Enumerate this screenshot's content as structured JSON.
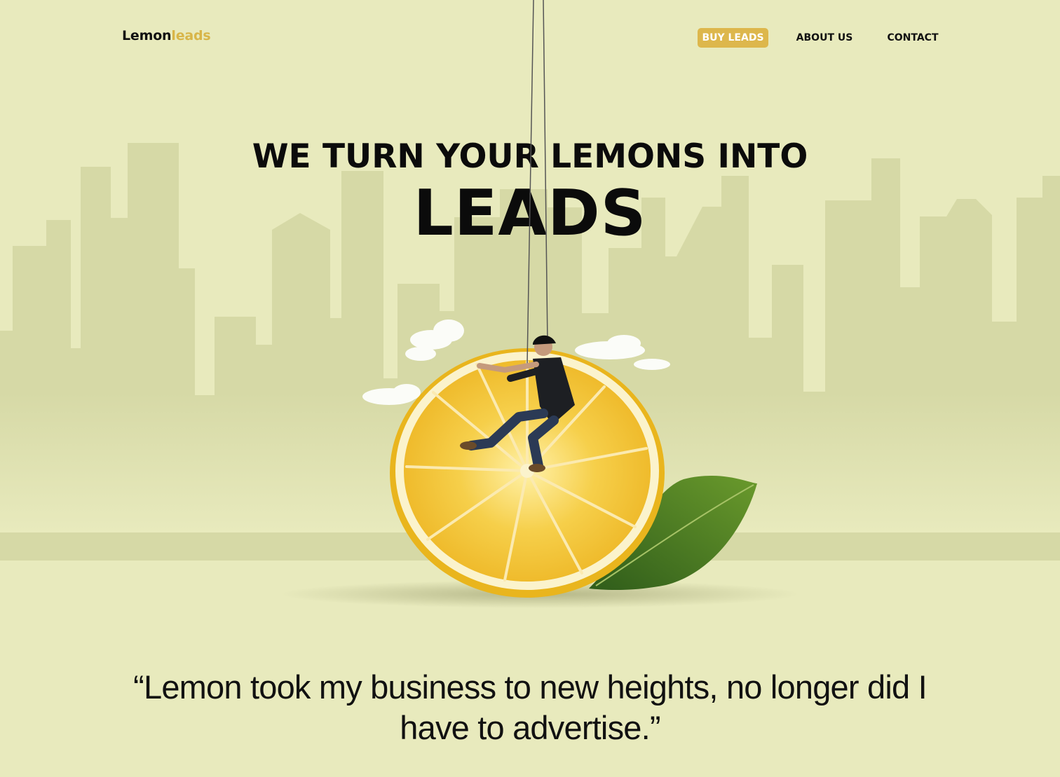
{
  "brand": {
    "name_part1": "Lemon",
    "name_part2": "leads",
    "accent_color": "#d8b548"
  },
  "nav": {
    "buy_leads": "BUY LEADS",
    "about_us": "ABOUT US",
    "contact": "CONTACT",
    "active_color": "#ddb74c"
  },
  "hero": {
    "line1": "WE TURN YOUR LEMONS INTO",
    "line2": "LEADS",
    "illustration_icons": [
      "city-skyline",
      "lemon-slice",
      "leaf",
      "climber",
      "clouds",
      "ropes"
    ]
  },
  "testimonial": {
    "quote": "“Lemon took my business to new heights, no longer did I have to advertise.”"
  },
  "colors": {
    "background": "#e8eabd",
    "skyline": "#d6d9a4",
    "lemon": "#f2c53a"
  }
}
